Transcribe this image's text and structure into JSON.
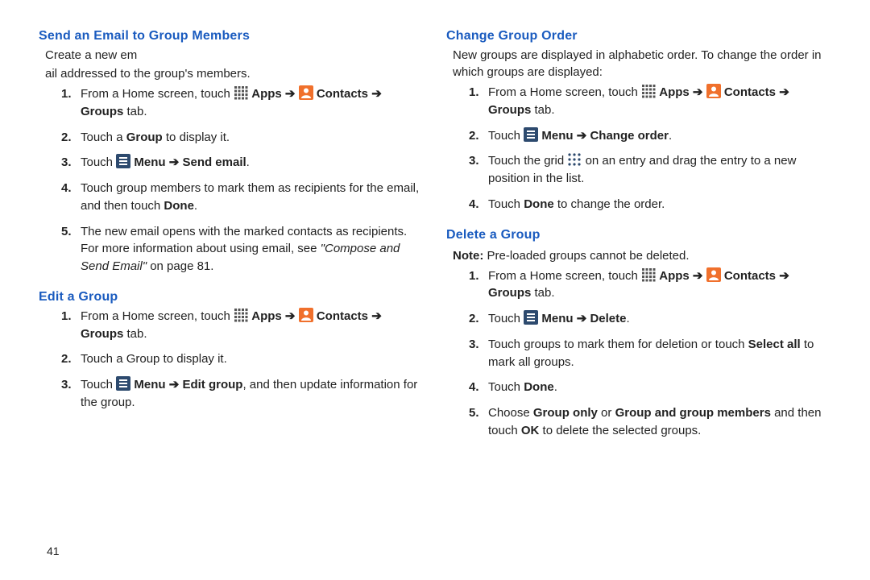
{
  "pageNumber": "41",
  "common": {
    "apps": "Apps",
    "contacts": "Contacts",
    "groupsTab": "Groups",
    "tab": "tab",
    "menu": "Menu",
    "arrow": "➔",
    "fromHome": "From a Home screen, touch",
    "touch": "Touch",
    "done": "Done"
  },
  "left": {
    "s1": {
      "title": "Send an Email to Group Members",
      "intro1": "Create a new em",
      "intro2": "ail addressed to the group's members.",
      "li2a": "Touch a ",
      "li2b": "Group",
      "li2c": " to display it.",
      "li3_action": "Send email",
      "li4a": "Touch group members to mark them as recipients for the email, and then touch ",
      "li4b": "Done",
      "li4c": ".",
      "li5a": "The new email opens with the marked contacts as recipients. For more information about using email, see ",
      "li5b": "\"Compose and Send Email\"",
      "li5c": " on page 81."
    },
    "s2": {
      "title": "Edit a Group",
      "li2": "Touch a Group to display it.",
      "li3_action": "Edit group",
      "li3_tail": ", and then update information for the group."
    }
  },
  "right": {
    "s1": {
      "title": "Change Group Order",
      "intro": "New groups are displayed in alphabetic order. To change the order in which groups are displayed:",
      "li2_action": "Change order",
      "li3a": "Touch the grid ",
      "li3b": " on an entry and drag the entry to a new position in the list.",
      "li4a": "Touch ",
      "li4b": "Done",
      "li4c": " to change the order."
    },
    "s2": {
      "title": "Delete a Group",
      "note_label": "Note:",
      "note_text": " Pre-loaded groups cannot be deleted.",
      "li2_action": "Delete",
      "li3a": "Touch groups to mark them for deletion or touch ",
      "li3b": "Select all",
      "li3c": " to mark all groups.",
      "li4a": "Touch ",
      "li4b": "Done",
      "li4c": ".",
      "li5a": "Choose ",
      "li5b": "Group only",
      "li5c": " or ",
      "li5d": "Group and group members",
      "li5e": " and then touch ",
      "li5f": "OK",
      "li5g": " to delete the selected groups."
    }
  }
}
